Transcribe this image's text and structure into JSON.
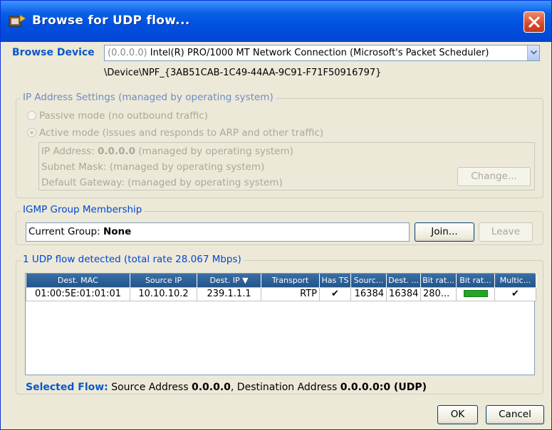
{
  "window": {
    "title": "Browse for UDP flow..."
  },
  "device": {
    "label": "Browse Device",
    "selected_ip": "(0.0.0.0)",
    "selected_name": "Intel(R) PRO/1000 MT Network Connection (Microsoft's Packet Scheduler)",
    "path": "\\Device\\NPF_{3AB51CAB-1C49-44AA-9C91-F71F50916797}"
  },
  "ip_settings": {
    "legend": "IP Address Settings (managed by operating system)",
    "passive_label": "Passive mode (no outbound traffic)",
    "active_label": "Active mode (issues and responds to ARP and other traffic)",
    "ip_prefix": "IP Address: ",
    "ip_value": "0.0.0.0",
    "ip_suffix": " (managed by operating system)",
    "subnet_text": "Subnet Mask: (managed by operating system)",
    "gateway_text": "Default Gateway: (managed by operating system)",
    "change_label": "Change..."
  },
  "igmp": {
    "legend": "IGMP Group Membership",
    "current_prefix": "Current Group: ",
    "current_value": "None",
    "join_label": "Join...",
    "leave_label": "Leave"
  },
  "flows": {
    "legend": "1 UDP flow detected (total rate 28.067 Mbps)",
    "columns": [
      "Dest. MAC",
      "Source IP",
      "Dest. IP",
      "Transport",
      "Has TS",
      "Sourc...",
      "Dest. ...",
      "Bit rat...",
      "Bit rat...",
      "Multic..."
    ],
    "rows": [
      {
        "dest_mac": "01:00:5E:01:01:01",
        "source_ip": "10.10.10.2",
        "dest_ip": "239.1.1.1",
        "transport": "RTP",
        "has_ts": "✔",
        "source_port": "16384",
        "dest_port": "16384",
        "bit_rate": "280...",
        "multicast": "✔"
      }
    ],
    "sort_indicator": "▼"
  },
  "selected_flow": {
    "label": "Selected Flow:",
    "src_prefix": " Source Address ",
    "src_value": "0.0.0.0",
    "dst_prefix": ", Destination Address ",
    "dst_value": "0.0.0.0:0 (UDP)"
  },
  "footer": {
    "ok_label": "OK",
    "cancel_label": "Cancel"
  },
  "colors": {
    "accent": "#0b58c8",
    "title_bar": "#0050e0",
    "close": "#d5492b",
    "bitrate_bar": "#23a623"
  }
}
